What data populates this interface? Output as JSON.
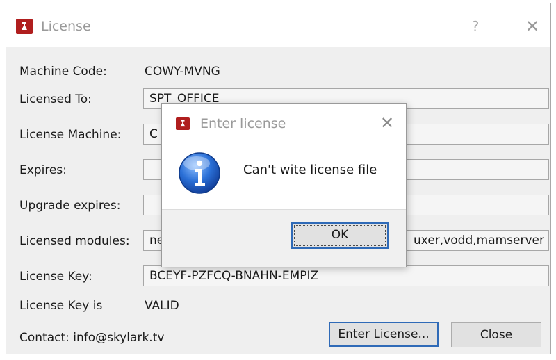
{
  "window": {
    "title": "License",
    "help_symbol": "?",
    "close_symbol": "✕",
    "app_icon": "skylark-red-logo-icon"
  },
  "rows": {
    "machine_code": {
      "label": "Machine Code:",
      "value": "COWY-MVNG"
    },
    "licensed_to": {
      "label": "Licensed To:",
      "value": "SPT_OFFICE"
    },
    "license_machine": {
      "label": "License Machine:",
      "value": "C"
    },
    "expires": {
      "label": "Expires:",
      "value": ""
    },
    "upgrade_expires": {
      "label": "Upgrade expires:",
      "value": ""
    },
    "licensed_modules": {
      "label": "Licensed modules:",
      "value_left": "ne",
      "value_right": "uxer,vodd,mamserver"
    },
    "license_key": {
      "label": "License Key:",
      "value": "BCEYF-PZFCQ-BNAHN-EMPIZ"
    },
    "license_key_is": {
      "label": "License Key is",
      "value": "VALID"
    }
  },
  "contact": "Contact: info@skylark.tv",
  "buttons": {
    "enter_license": "Enter License...",
    "close": "Close"
  },
  "dialog": {
    "title": "Enter license",
    "close_symbol": "✕",
    "message": "Can't wite license file",
    "ok": "OK",
    "icon": "info-icon"
  },
  "colors": {
    "accent_focus": "#2f6ab7",
    "app_icon_red": "#b01e1e",
    "info_blue": "#1f5fc6"
  }
}
